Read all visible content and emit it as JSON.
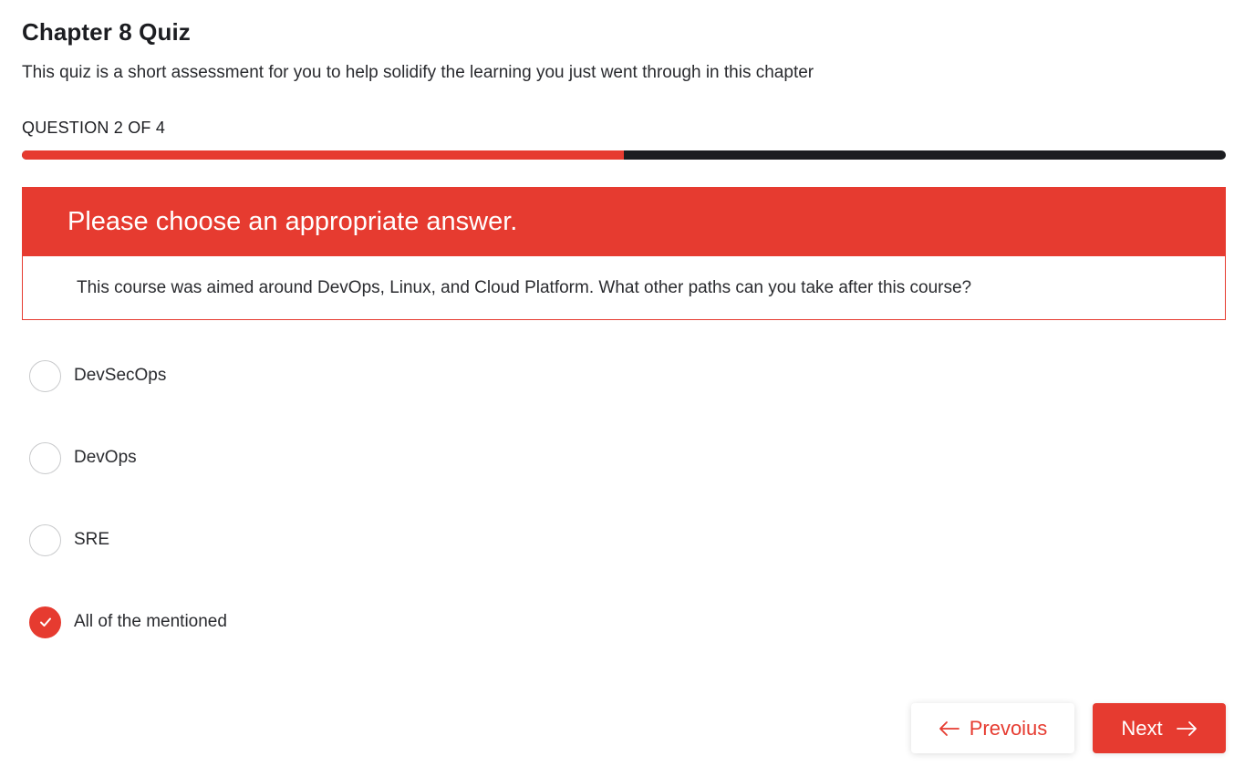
{
  "quiz": {
    "title": "Chapter 8 Quiz",
    "subtitle": "This quiz is a short assessment for you to help solidify the learning you just went through in this chapter"
  },
  "progress": {
    "label": "QUESTION 2 OF 4",
    "fraction": 0.5,
    "fill_color": "#e63b30",
    "track_color": "#1c1d21"
  },
  "question": {
    "header": "Please choose an appropriate answer.",
    "text": "This course was aimed around DevOps, Linux, and Cloud Platform. What other paths can you take after this course?"
  },
  "options": [
    {
      "label": "DevSecOps",
      "selected": false
    },
    {
      "label": "DevOps",
      "selected": false
    },
    {
      "label": "SRE",
      "selected": false
    },
    {
      "label": "All of the mentioned",
      "selected": true,
      "icon": "check-icon"
    }
  ],
  "nav": {
    "prev_label": "Prevoius",
    "prev_icon": "arrow-left-icon",
    "next_label": "Next",
    "next_icon": "arrow-right-icon"
  },
  "colors": {
    "accent": "#e63b30",
    "text": "#1c1d21"
  }
}
